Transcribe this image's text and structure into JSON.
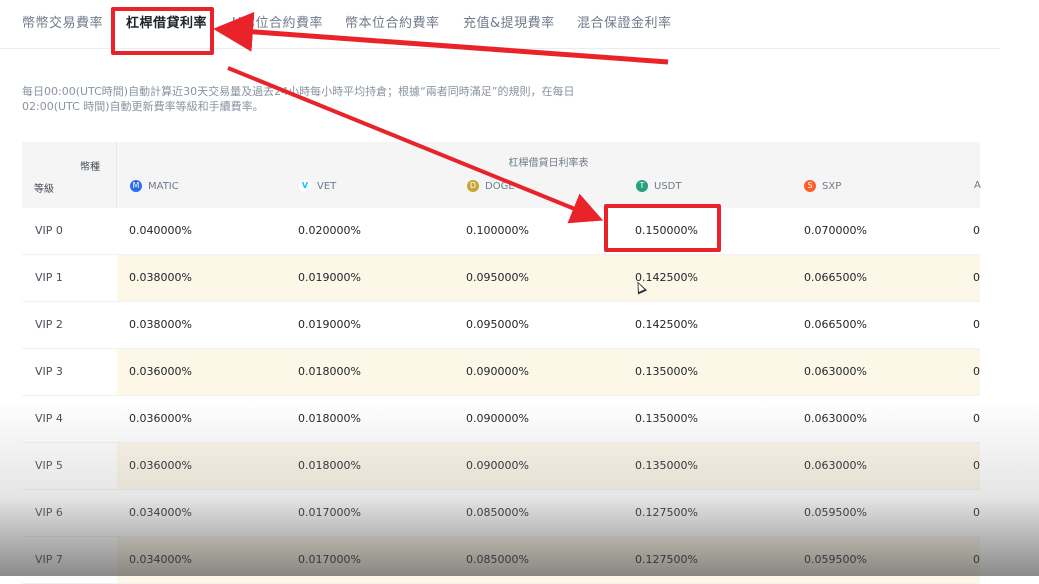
{
  "tabs": [
    {
      "label": "幣幣交易費率"
    },
    {
      "label": "杠桿借貸利率"
    },
    {
      "label": "U本位合約費率"
    },
    {
      "label": "幣本位合約費率"
    },
    {
      "label": "充值&提現費率"
    },
    {
      "label": "混合保證金利率"
    }
  ],
  "active_tab": 1,
  "notice": "每日00:00(UTC時間)自動計算近30天交易量及過去24小時每小時平均持倉；根據“兩者同時滿足”的規則，在每日02:00(UTC 時間)自動更新費率等級和手續費率。",
  "table": {
    "corner_top": "幣種",
    "corner_bottom": "等級",
    "group_title": "杠桿借貸日利率表",
    "coins": [
      {
        "name": "MATIC",
        "icon": "matic-icon",
        "color": "#2b6def"
      },
      {
        "name": "VET",
        "icon": "vet-icon",
        "color": "#15bdff"
      },
      {
        "name": "DOGE",
        "icon": "doge-icon",
        "color": "#c3a634"
      },
      {
        "name": "USDT",
        "icon": "usdt-icon",
        "color": "#26a17b"
      },
      {
        "name": "SXP",
        "icon": "sxp-icon",
        "color": "#fd5f2b"
      },
      {
        "name": "A",
        "icon": "coin-icon",
        "color": "#888888"
      }
    ],
    "rows": [
      {
        "level": "VIP 0",
        "values": [
          "0.040000%",
          "0.020000%",
          "0.100000%",
          "0.150000%",
          "0.070000%",
          "0"
        ]
      },
      {
        "level": "VIP 1",
        "values": [
          "0.038000%",
          "0.019000%",
          "0.095000%",
          "0.142500%",
          "0.066500%",
          "0"
        ]
      },
      {
        "level": "VIP 2",
        "values": [
          "0.038000%",
          "0.019000%",
          "0.095000%",
          "0.142500%",
          "0.066500%",
          "0"
        ]
      },
      {
        "level": "VIP 3",
        "values": [
          "0.036000%",
          "0.018000%",
          "0.090000%",
          "0.135000%",
          "0.063000%",
          "0"
        ]
      },
      {
        "level": "VIP 4",
        "values": [
          "0.036000%",
          "0.018000%",
          "0.090000%",
          "0.135000%",
          "0.063000%",
          "0"
        ]
      },
      {
        "level": "VIP 5",
        "values": [
          "0.036000%",
          "0.018000%",
          "0.090000%",
          "0.135000%",
          "0.063000%",
          "0"
        ]
      },
      {
        "level": "VIP 6",
        "values": [
          "0.034000%",
          "0.017000%",
          "0.085000%",
          "0.127500%",
          "0.059500%",
          "0"
        ]
      },
      {
        "level": "VIP 7",
        "values": [
          "0.034000%",
          "0.017000%",
          "0.085000%",
          "0.127500%",
          "0.059500%",
          "0"
        ]
      }
    ]
  },
  "colors": {
    "highlight": "#e8232a",
    "alt_row": "#fdf7e8"
  }
}
